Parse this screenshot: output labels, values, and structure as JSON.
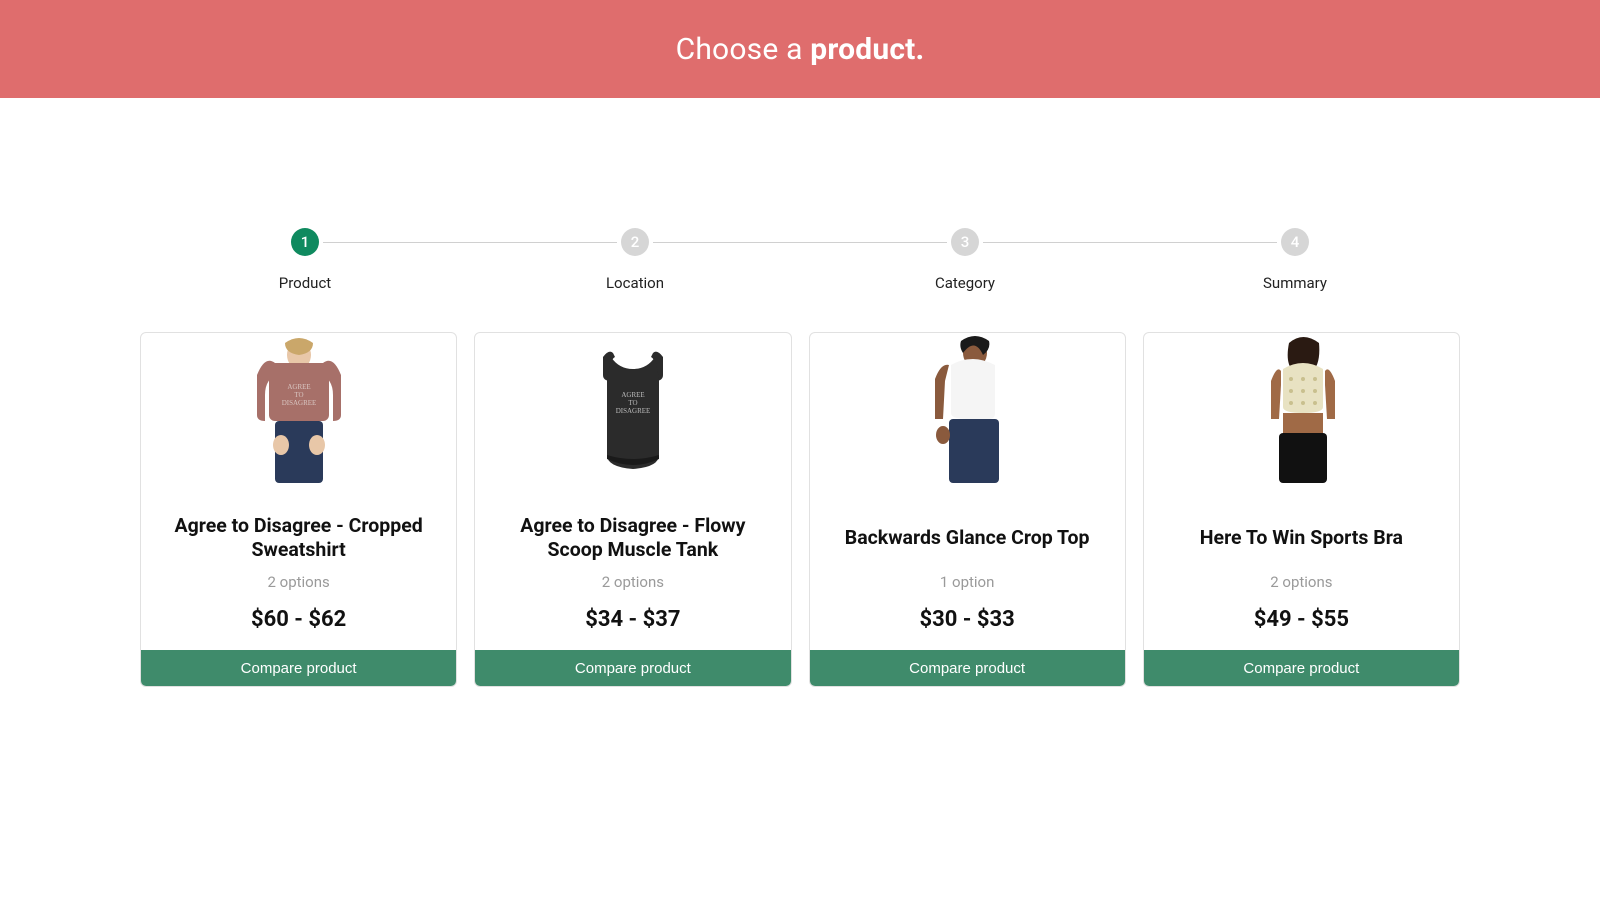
{
  "colors": {
    "accent": "#df6d6d",
    "primary": "#3f8b6b",
    "step_active": "#0f8a5f",
    "step_idle": "#d6d6d6"
  },
  "header": {
    "light": "Choose a ",
    "bold": "product."
  },
  "steps": [
    {
      "num": "1",
      "label": "Product",
      "active": true
    },
    {
      "num": "2",
      "label": "Location",
      "active": false
    },
    {
      "num": "3",
      "label": "Category",
      "active": false
    },
    {
      "num": "4",
      "label": "Summary",
      "active": false
    }
  ],
  "compare_label": "Compare product",
  "products": [
    {
      "title": "Agree to Disagree - Cropped Sweatshirt",
      "options": "2 options",
      "price": "$60 - $62",
      "image": "sweatshirt"
    },
    {
      "title": "Agree to Disagree - Flowy Scoop Muscle Tank",
      "options": "2 options",
      "price": "$34 - $37",
      "image": "tank"
    },
    {
      "title": "Backwards Glance Crop Top",
      "options": "1 option",
      "price": "$30 - $33",
      "image": "croptop"
    },
    {
      "title": "Here To Win Sports Bra",
      "options": "2 options",
      "price": "$49 - $55",
      "image": "sportsbra"
    }
  ]
}
